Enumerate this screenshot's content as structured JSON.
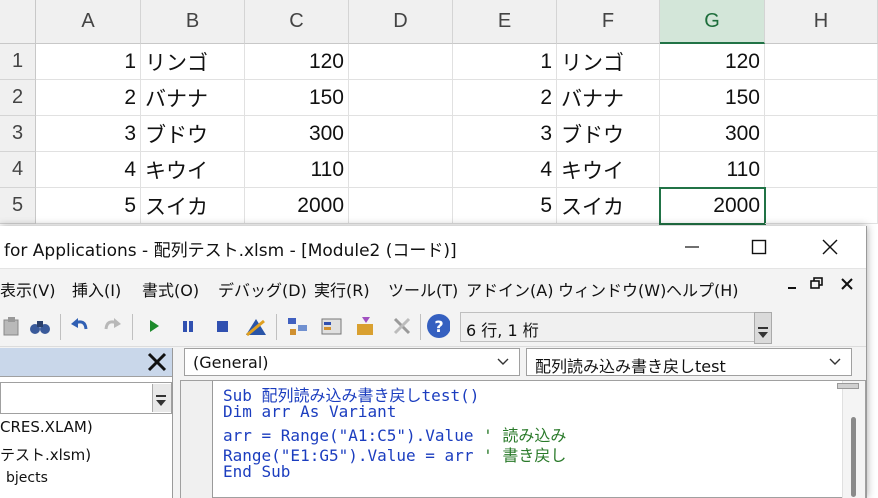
{
  "sheet": {
    "columns": [
      "A",
      "B",
      "C",
      "D",
      "E",
      "F",
      "G",
      "H"
    ],
    "rows": [
      "1",
      "2",
      "3",
      "4",
      "5"
    ],
    "data": [
      {
        "a": "1",
        "b": "リンゴ",
        "c": "120",
        "e": "1",
        "f": "リンゴ",
        "g": "120"
      },
      {
        "a": "2",
        "b": "バナナ",
        "c": "150",
        "e": "2",
        "f": "バナナ",
        "g": "150"
      },
      {
        "a": "3",
        "b": "ブドウ",
        "c": "300",
        "e": "3",
        "f": "ブドウ",
        "g": "300"
      },
      {
        "a": "4",
        "b": "キウイ",
        "c": "110",
        "e": "4",
        "f": "キウイ",
        "g": "110"
      },
      {
        "a": "5",
        "b": "スイカ",
        "c": "2000",
        "e": "5",
        "f": "スイカ",
        "g": "2000"
      }
    ],
    "accent": "#217346"
  },
  "vbe": {
    "title": "for Applications - 配列テスト.xlsm - [Module2 (コード)]",
    "menu": [
      "表示(V)",
      "挿入(I)",
      "書式(O)",
      "デバッグ(D)",
      "実行(R)",
      "ツール(T)",
      "アドイン(A)",
      "ウィンドウ(W)",
      "ヘルプ(H)"
    ],
    "position": "6 行, 1 桁",
    "project": {
      "items": [
        "CRES.XLAM)",
        "テスト.xlsm)",
        "bjects"
      ]
    },
    "code": {
      "object_combo": "(General)",
      "proc_combo": "配列読み込み書き戻しtest",
      "lines": {
        "l1_kw": "Sub",
        "l1_rest": "配列読み込み書き戻しtest()",
        "l2_kw": "Dim",
        "l2_mid": "arr",
        "l2_kw2": "As",
        "l2_type": "Variant",
        "l3_code": "arr = Range(\"A1:C5\").Value",
        "l3_cmt": "' 読み込み",
        "l4_code": "Range(\"E1:G5\").Value = arr",
        "l4_cmt": "' 書き戻し",
        "l5_kw": "End Sub"
      }
    }
  }
}
